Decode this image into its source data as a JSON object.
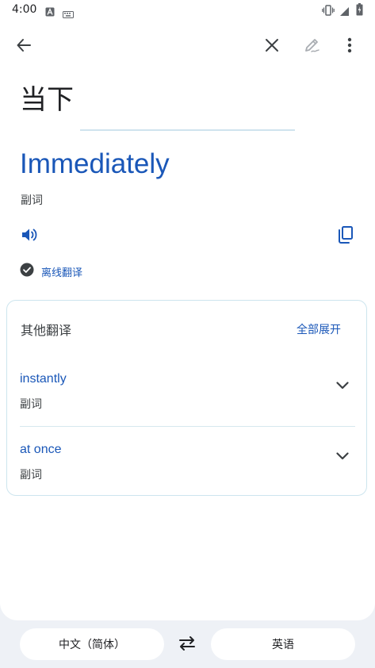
{
  "status_bar": {
    "time": "4:00",
    "icons": [
      "a-box-icon",
      "keyboard-icon",
      "vibrate-icon",
      "signal-icon",
      "battery-icon"
    ]
  },
  "toolbar": {
    "back": "arrow-back-icon",
    "clear": "close-icon",
    "edit": "edit-pen-icon",
    "more": "more-vert-icon"
  },
  "source": {
    "text": "当下"
  },
  "translation": {
    "text": "Immediately",
    "part_of_speech": "副词",
    "offline_label": "离线翻译"
  },
  "alternatives": {
    "title": "其他翻译",
    "expand_all": "全部展开",
    "items": [
      {
        "word": "instantly",
        "part_of_speech": "副词"
      },
      {
        "word": "at once",
        "part_of_speech": "副词"
      }
    ]
  },
  "languages": {
    "source": "中文（简体）",
    "target": "英语"
  },
  "colors": {
    "accent": "#1a57b8",
    "background": "#eef1f6",
    "card_border": "#cde5ee"
  }
}
